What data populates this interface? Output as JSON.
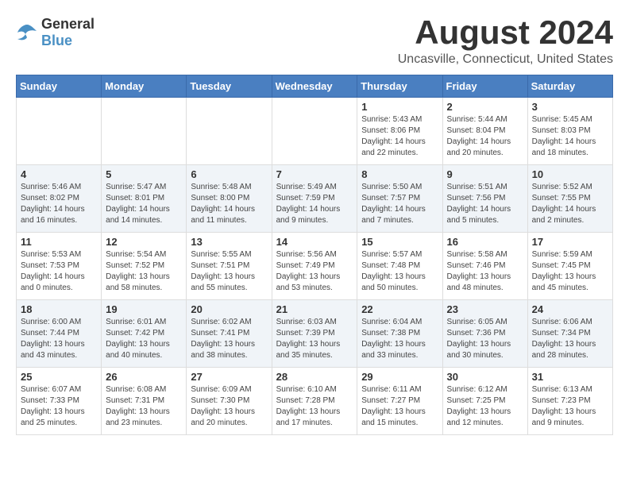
{
  "logo": {
    "general": "General",
    "blue": "Blue"
  },
  "title": "August 2024",
  "subtitle": "Uncasville, Connecticut, United States",
  "days_header": [
    "Sunday",
    "Monday",
    "Tuesday",
    "Wednesday",
    "Thursday",
    "Friday",
    "Saturday"
  ],
  "weeks": [
    [
      {
        "day": "",
        "sunrise": "",
        "sunset": "",
        "daylight": ""
      },
      {
        "day": "",
        "sunrise": "",
        "sunset": "",
        "daylight": ""
      },
      {
        "day": "",
        "sunrise": "",
        "sunset": "",
        "daylight": ""
      },
      {
        "day": "",
        "sunrise": "",
        "sunset": "",
        "daylight": ""
      },
      {
        "day": "1",
        "sunrise": "Sunrise: 5:43 AM",
        "sunset": "Sunset: 8:06 PM",
        "daylight": "Daylight: 14 hours and 22 minutes."
      },
      {
        "day": "2",
        "sunrise": "Sunrise: 5:44 AM",
        "sunset": "Sunset: 8:04 PM",
        "daylight": "Daylight: 14 hours and 20 minutes."
      },
      {
        "day": "3",
        "sunrise": "Sunrise: 5:45 AM",
        "sunset": "Sunset: 8:03 PM",
        "daylight": "Daylight: 14 hours and 18 minutes."
      }
    ],
    [
      {
        "day": "4",
        "sunrise": "Sunrise: 5:46 AM",
        "sunset": "Sunset: 8:02 PM",
        "daylight": "Daylight: 14 hours and 16 minutes."
      },
      {
        "day": "5",
        "sunrise": "Sunrise: 5:47 AM",
        "sunset": "Sunset: 8:01 PM",
        "daylight": "Daylight: 14 hours and 14 minutes."
      },
      {
        "day": "6",
        "sunrise": "Sunrise: 5:48 AM",
        "sunset": "Sunset: 8:00 PM",
        "daylight": "Daylight: 14 hours and 11 minutes."
      },
      {
        "day": "7",
        "sunrise": "Sunrise: 5:49 AM",
        "sunset": "Sunset: 7:59 PM",
        "daylight": "Daylight: 14 hours and 9 minutes."
      },
      {
        "day": "8",
        "sunrise": "Sunrise: 5:50 AM",
        "sunset": "Sunset: 7:57 PM",
        "daylight": "Daylight: 14 hours and 7 minutes."
      },
      {
        "day": "9",
        "sunrise": "Sunrise: 5:51 AM",
        "sunset": "Sunset: 7:56 PM",
        "daylight": "Daylight: 14 hours and 5 minutes."
      },
      {
        "day": "10",
        "sunrise": "Sunrise: 5:52 AM",
        "sunset": "Sunset: 7:55 PM",
        "daylight": "Daylight: 14 hours and 2 minutes."
      }
    ],
    [
      {
        "day": "11",
        "sunrise": "Sunrise: 5:53 AM",
        "sunset": "Sunset: 7:53 PM",
        "daylight": "Daylight: 14 hours and 0 minutes."
      },
      {
        "day": "12",
        "sunrise": "Sunrise: 5:54 AM",
        "sunset": "Sunset: 7:52 PM",
        "daylight": "Daylight: 13 hours and 58 minutes."
      },
      {
        "day": "13",
        "sunrise": "Sunrise: 5:55 AM",
        "sunset": "Sunset: 7:51 PM",
        "daylight": "Daylight: 13 hours and 55 minutes."
      },
      {
        "day": "14",
        "sunrise": "Sunrise: 5:56 AM",
        "sunset": "Sunset: 7:49 PM",
        "daylight": "Daylight: 13 hours and 53 minutes."
      },
      {
        "day": "15",
        "sunrise": "Sunrise: 5:57 AM",
        "sunset": "Sunset: 7:48 PM",
        "daylight": "Daylight: 13 hours and 50 minutes."
      },
      {
        "day": "16",
        "sunrise": "Sunrise: 5:58 AM",
        "sunset": "Sunset: 7:46 PM",
        "daylight": "Daylight: 13 hours and 48 minutes."
      },
      {
        "day": "17",
        "sunrise": "Sunrise: 5:59 AM",
        "sunset": "Sunset: 7:45 PM",
        "daylight": "Daylight: 13 hours and 45 minutes."
      }
    ],
    [
      {
        "day": "18",
        "sunrise": "Sunrise: 6:00 AM",
        "sunset": "Sunset: 7:44 PM",
        "daylight": "Daylight: 13 hours and 43 minutes."
      },
      {
        "day": "19",
        "sunrise": "Sunrise: 6:01 AM",
        "sunset": "Sunset: 7:42 PM",
        "daylight": "Daylight: 13 hours and 40 minutes."
      },
      {
        "day": "20",
        "sunrise": "Sunrise: 6:02 AM",
        "sunset": "Sunset: 7:41 PM",
        "daylight": "Daylight: 13 hours and 38 minutes."
      },
      {
        "day": "21",
        "sunrise": "Sunrise: 6:03 AM",
        "sunset": "Sunset: 7:39 PM",
        "daylight": "Daylight: 13 hours and 35 minutes."
      },
      {
        "day": "22",
        "sunrise": "Sunrise: 6:04 AM",
        "sunset": "Sunset: 7:38 PM",
        "daylight": "Daylight: 13 hours and 33 minutes."
      },
      {
        "day": "23",
        "sunrise": "Sunrise: 6:05 AM",
        "sunset": "Sunset: 7:36 PM",
        "daylight": "Daylight: 13 hours and 30 minutes."
      },
      {
        "day": "24",
        "sunrise": "Sunrise: 6:06 AM",
        "sunset": "Sunset: 7:34 PM",
        "daylight": "Daylight: 13 hours and 28 minutes."
      }
    ],
    [
      {
        "day": "25",
        "sunrise": "Sunrise: 6:07 AM",
        "sunset": "Sunset: 7:33 PM",
        "daylight": "Daylight: 13 hours and 25 minutes."
      },
      {
        "day": "26",
        "sunrise": "Sunrise: 6:08 AM",
        "sunset": "Sunset: 7:31 PM",
        "daylight": "Daylight: 13 hours and 23 minutes."
      },
      {
        "day": "27",
        "sunrise": "Sunrise: 6:09 AM",
        "sunset": "Sunset: 7:30 PM",
        "daylight": "Daylight: 13 hours and 20 minutes."
      },
      {
        "day": "28",
        "sunrise": "Sunrise: 6:10 AM",
        "sunset": "Sunset: 7:28 PM",
        "daylight": "Daylight: 13 hours and 17 minutes."
      },
      {
        "day": "29",
        "sunrise": "Sunrise: 6:11 AM",
        "sunset": "Sunset: 7:27 PM",
        "daylight": "Daylight: 13 hours and 15 minutes."
      },
      {
        "day": "30",
        "sunrise": "Sunrise: 6:12 AM",
        "sunset": "Sunset: 7:25 PM",
        "daylight": "Daylight: 13 hours and 12 minutes."
      },
      {
        "day": "31",
        "sunrise": "Sunrise: 6:13 AM",
        "sunset": "Sunset: 7:23 PM",
        "daylight": "Daylight: 13 hours and 9 minutes."
      }
    ]
  ]
}
